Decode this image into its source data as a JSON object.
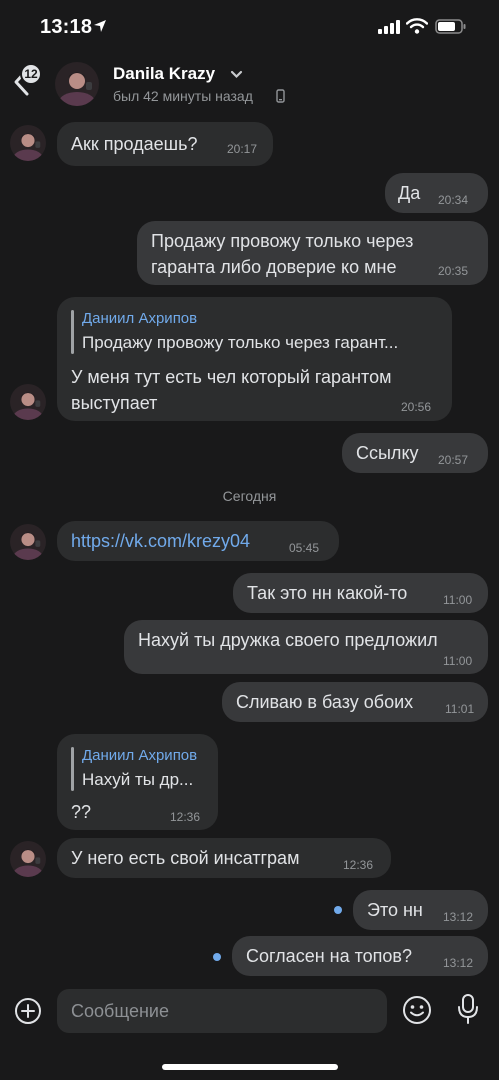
{
  "status_bar": {
    "time": "13:18"
  },
  "header": {
    "back_badge": "12",
    "name": "Danila Krazy",
    "status": "был 42 минуты назад"
  },
  "messages": [
    {
      "dir": "in",
      "text": "Акк продаешь?",
      "time": "20:17"
    },
    {
      "dir": "out",
      "text": "Да",
      "time": "20:34"
    },
    {
      "dir": "out",
      "lines": [
        "Продажу провожу только через",
        "гаранта либо доверие ко мне"
      ],
      "time": "20:35"
    },
    {
      "dir": "in",
      "reply": {
        "author": "Даниил Ахрипов",
        "text": "Продажу провожу только через гарант..."
      },
      "lines": [
        "У меня тут есть чел  который гарантом",
        "выступает"
      ],
      "time": "20:56"
    },
    {
      "dir": "out",
      "text": "Ссылку",
      "time": "20:57"
    },
    {
      "dir": "in",
      "text": "https://vk.com/krezy04",
      "time": "05:45"
    },
    {
      "dir": "out",
      "text": "Так это нн какой-то",
      "time": "11:00"
    },
    {
      "dir": "out",
      "text": "Нахуй ты дружка своего предложил",
      "time": "11:00"
    },
    {
      "dir": "out",
      "text": "Сливаю в базу обоих",
      "time": "11:01"
    },
    {
      "dir": "in",
      "reply": {
        "author": "Даниил Ахрипов",
        "text": "Нахуй ты др..."
      },
      "text": "??",
      "time": "12:36"
    },
    {
      "dir": "in",
      "text": "У него есть свой инсатграм",
      "time": "12:36"
    },
    {
      "dir": "out",
      "text": "Это нн",
      "time": "13:12",
      "unread": true
    },
    {
      "dir": "out",
      "text": "Согласен на топов?",
      "time": "13:12",
      "unread": true
    }
  ],
  "date_separator": "Сегодня",
  "composer": {
    "placeholder": "Сообщение"
  },
  "colors": {
    "background": "#19191a",
    "bubble_in": "#2c2d2e",
    "bubble_out": "#38393b",
    "accent": "#71aaeb"
  },
  "icons": [
    "location-arrow-icon",
    "signal-icon",
    "wifi-icon",
    "battery-icon",
    "back-chevron-icon",
    "chevron-down-icon",
    "phone-icon",
    "plus-icon",
    "emoji-icon",
    "microphone-icon"
  ]
}
